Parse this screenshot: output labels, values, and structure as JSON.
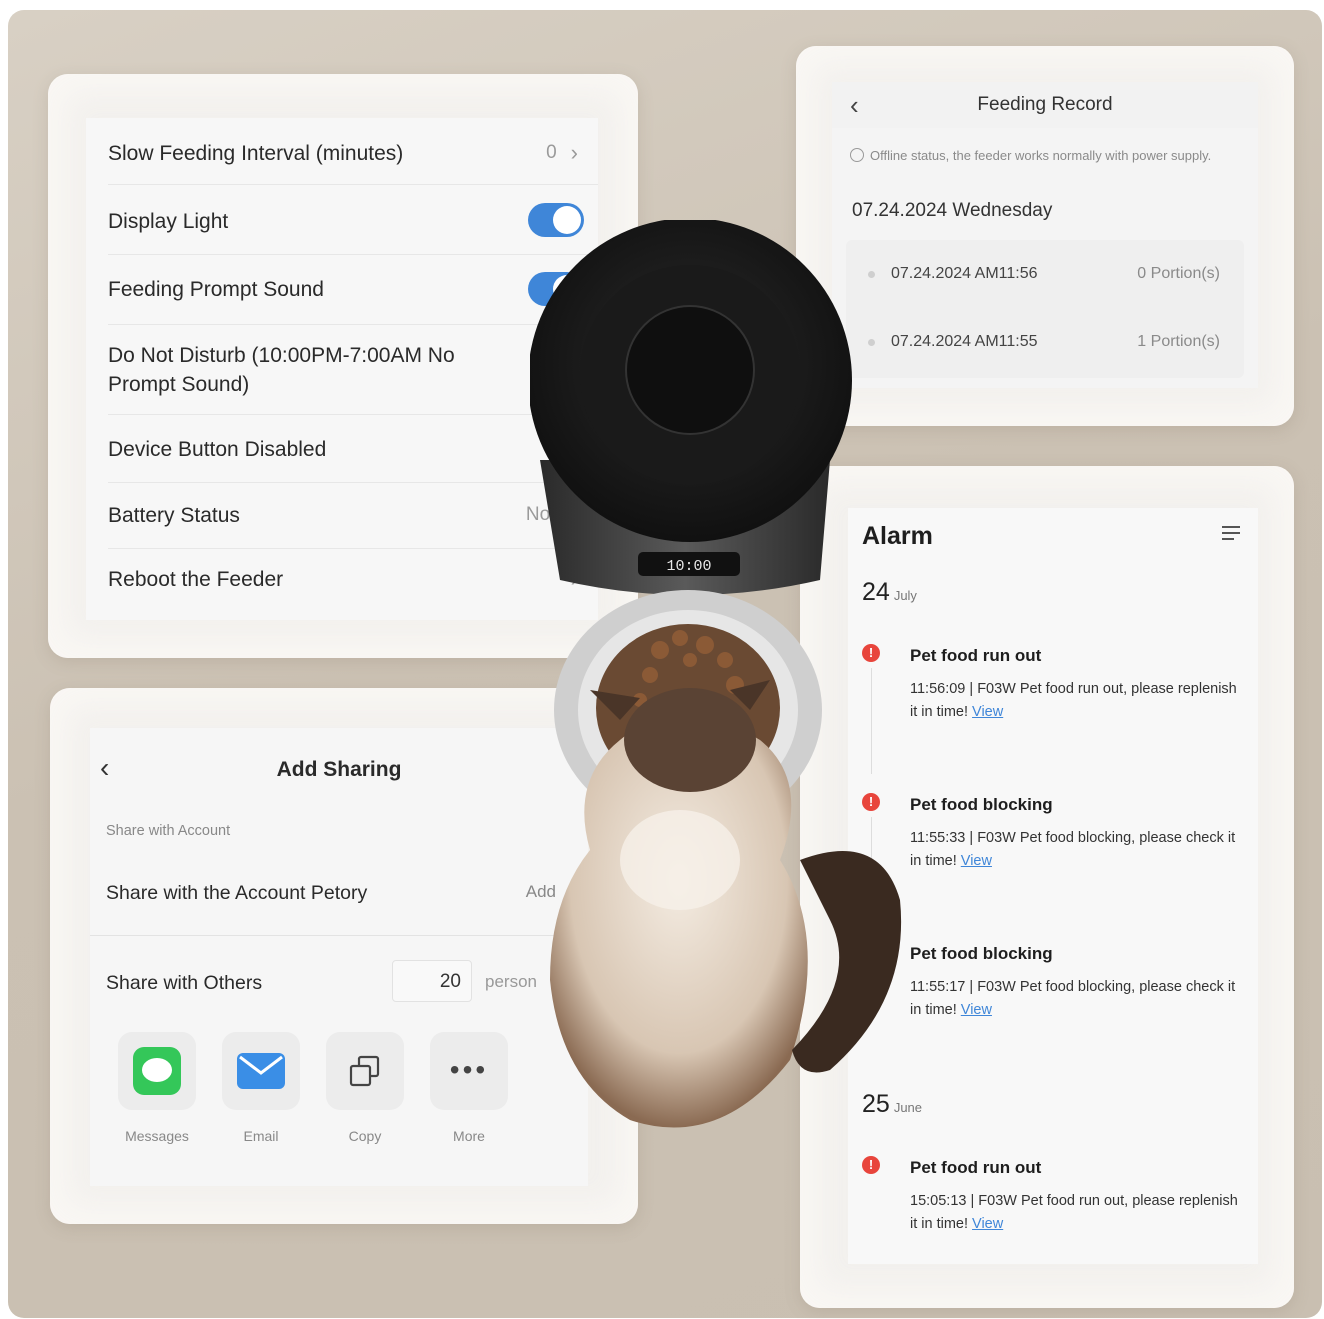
{
  "settings": {
    "rows": [
      {
        "label": "Slow Feeding Interval (minutes)",
        "value": "0"
      },
      {
        "label": "Display Light"
      },
      {
        "label": "Feeding Prompt Sound"
      },
      {
        "label": "Do Not Disturb (10:00PM-7:00AM No Prompt Sound)"
      },
      {
        "label": "Device Button Disabled"
      },
      {
        "label": "Battery Status",
        "value": "No Bat"
      },
      {
        "label": "Reboot the Feeder"
      }
    ],
    "display_light_on": true,
    "feeding_prompt_sound_on": true
  },
  "feeding_record": {
    "title": "Feeding Record",
    "note": "Offline status, the feeder works normally with power supply.",
    "date": "07.24.2024 Wednesday",
    "items": [
      {
        "time": "07.24.2024 AM11:56",
        "portions": "0 Portion(s)"
      },
      {
        "time": "07.24.2024 AM11:55",
        "portions": "1 Portion(s)"
      }
    ]
  },
  "alarm": {
    "title": "Alarm",
    "days": [
      {
        "day": "24",
        "month": "July"
      },
      {
        "day": "25",
        "month": "June"
      }
    ],
    "entries": [
      {
        "title": "Pet food run out",
        "text": "11:56:09 | F03W Pet food run out, please replenish it in time!",
        "link": "View"
      },
      {
        "title": "Pet food blocking",
        "text": "11:55:33 | F03W Pet food blocking, please check it in time!",
        "link": "View"
      },
      {
        "title": "Pet food blocking",
        "text": "11:55:17 | F03W Pet food blocking, please check it in time!",
        "link": "View"
      },
      {
        "title": "Pet food run out",
        "text": "15:05:13 | F03W Pet food run out, please replenish it in time!",
        "link": "View"
      }
    ]
  },
  "sharing": {
    "title": "Add Sharing",
    "subtitle": "Share with Account",
    "account_row": "Share with the Account Petory",
    "add_label": "Add",
    "others_row": "Share with Others",
    "count": "20",
    "unit": "person",
    "apps": [
      {
        "label": "Messages",
        "icon": "messages-icon"
      },
      {
        "label": "Email",
        "icon": "email-icon"
      },
      {
        "label": "Copy",
        "icon": "copy-icon"
      },
      {
        "label": "More",
        "icon": "more-icon"
      }
    ]
  },
  "device_display": "10:00",
  "colors": {
    "toggle": "#3f86d8",
    "alarm": "#e8453c",
    "link": "#3f86d8",
    "messages": "#34c759",
    "email": "#3a8ee6"
  }
}
